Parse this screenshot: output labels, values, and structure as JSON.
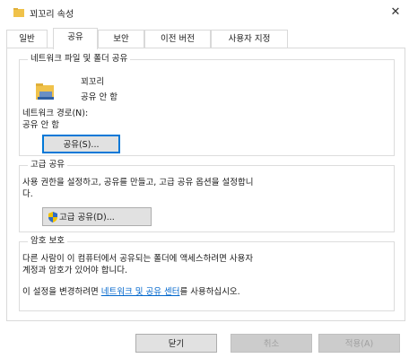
{
  "window": {
    "title": "꾀꼬리 속성"
  },
  "tabs": [
    {
      "label": "일반"
    },
    {
      "label": "공유"
    },
    {
      "label": "보안"
    },
    {
      "label": "이전 버전"
    },
    {
      "label": "사용자 지정"
    }
  ],
  "active_tab": "공유",
  "network_share": {
    "group_title": "네트워크 파일 및 폴더 공유",
    "folder_name": "꾀꼬리",
    "share_status": "공유 안 함",
    "path_label": "네트워크 경로(N):",
    "path_value": "공유 안 함",
    "share_button": "공유(S)..."
  },
  "advanced_share": {
    "group_title": "고급 공유",
    "description_line1": "사용 권한을 설정하고, 공유를 만들고, 고급 공유 옵션을 설정합니",
    "description_line2": "다.",
    "button": "고급 공유(D)..."
  },
  "password_protection": {
    "group_title": "암호 보호",
    "description_line1": "다른 사람이 이 컴퓨터에서 공유되는 폴더에 액세스하려면 사용자",
    "description_line2": "계정과 암호가 있어야 합니다.",
    "change_prefix": "이 설정을 변경하려면 ",
    "link_text": "네트워크 및 공유 센터",
    "change_suffix": "를 사용하십시오."
  },
  "footer": {
    "close_button": "닫기",
    "cancel_button": "취소",
    "apply_button": "적용(A)"
  },
  "colors": {
    "accent": "#0078d7",
    "link": "#0066cc",
    "folder": "#f0c24a"
  },
  "icons": {
    "title": "folder-icon",
    "close": "close-icon",
    "shared_folder": "folder-icon",
    "advanced_share_button": "uac-shield-icon"
  }
}
